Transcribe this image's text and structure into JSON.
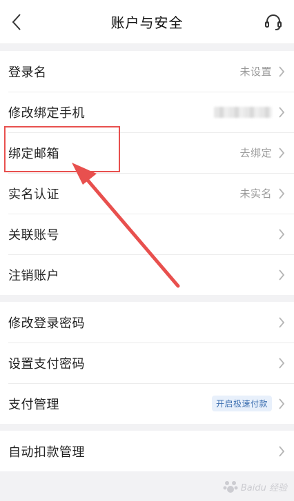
{
  "header": {
    "title": "账户与安全",
    "back_icon": "chevron-left-icon",
    "support_icon": "headset-icon"
  },
  "groups": [
    {
      "items": [
        {
          "label": "登录名",
          "value": "未设置"
        },
        {
          "label": "修改绑定手机",
          "value": ""
        },
        {
          "label": "绑定邮箱",
          "value": "去绑定"
        },
        {
          "label": "实名认证",
          "value": "未实名"
        },
        {
          "label": "关联账号",
          "value": ""
        },
        {
          "label": "注销账户",
          "value": ""
        }
      ]
    },
    {
      "items": [
        {
          "label": "修改登录密码",
          "value": ""
        },
        {
          "label": "设置支付密码",
          "value": ""
        },
        {
          "label": "支付管理",
          "tag": "开启极速付款"
        }
      ]
    },
    {
      "items": [
        {
          "label": "自动扣款管理",
          "value": ""
        }
      ]
    }
  ],
  "watermark": {
    "text": "Baidu 经验"
  },
  "colors": {
    "highlight": "#e8504e",
    "tag_text": "#3d6fb0",
    "tag_bg": "#e8f0fb",
    "value_text": "#9a9a9a"
  }
}
